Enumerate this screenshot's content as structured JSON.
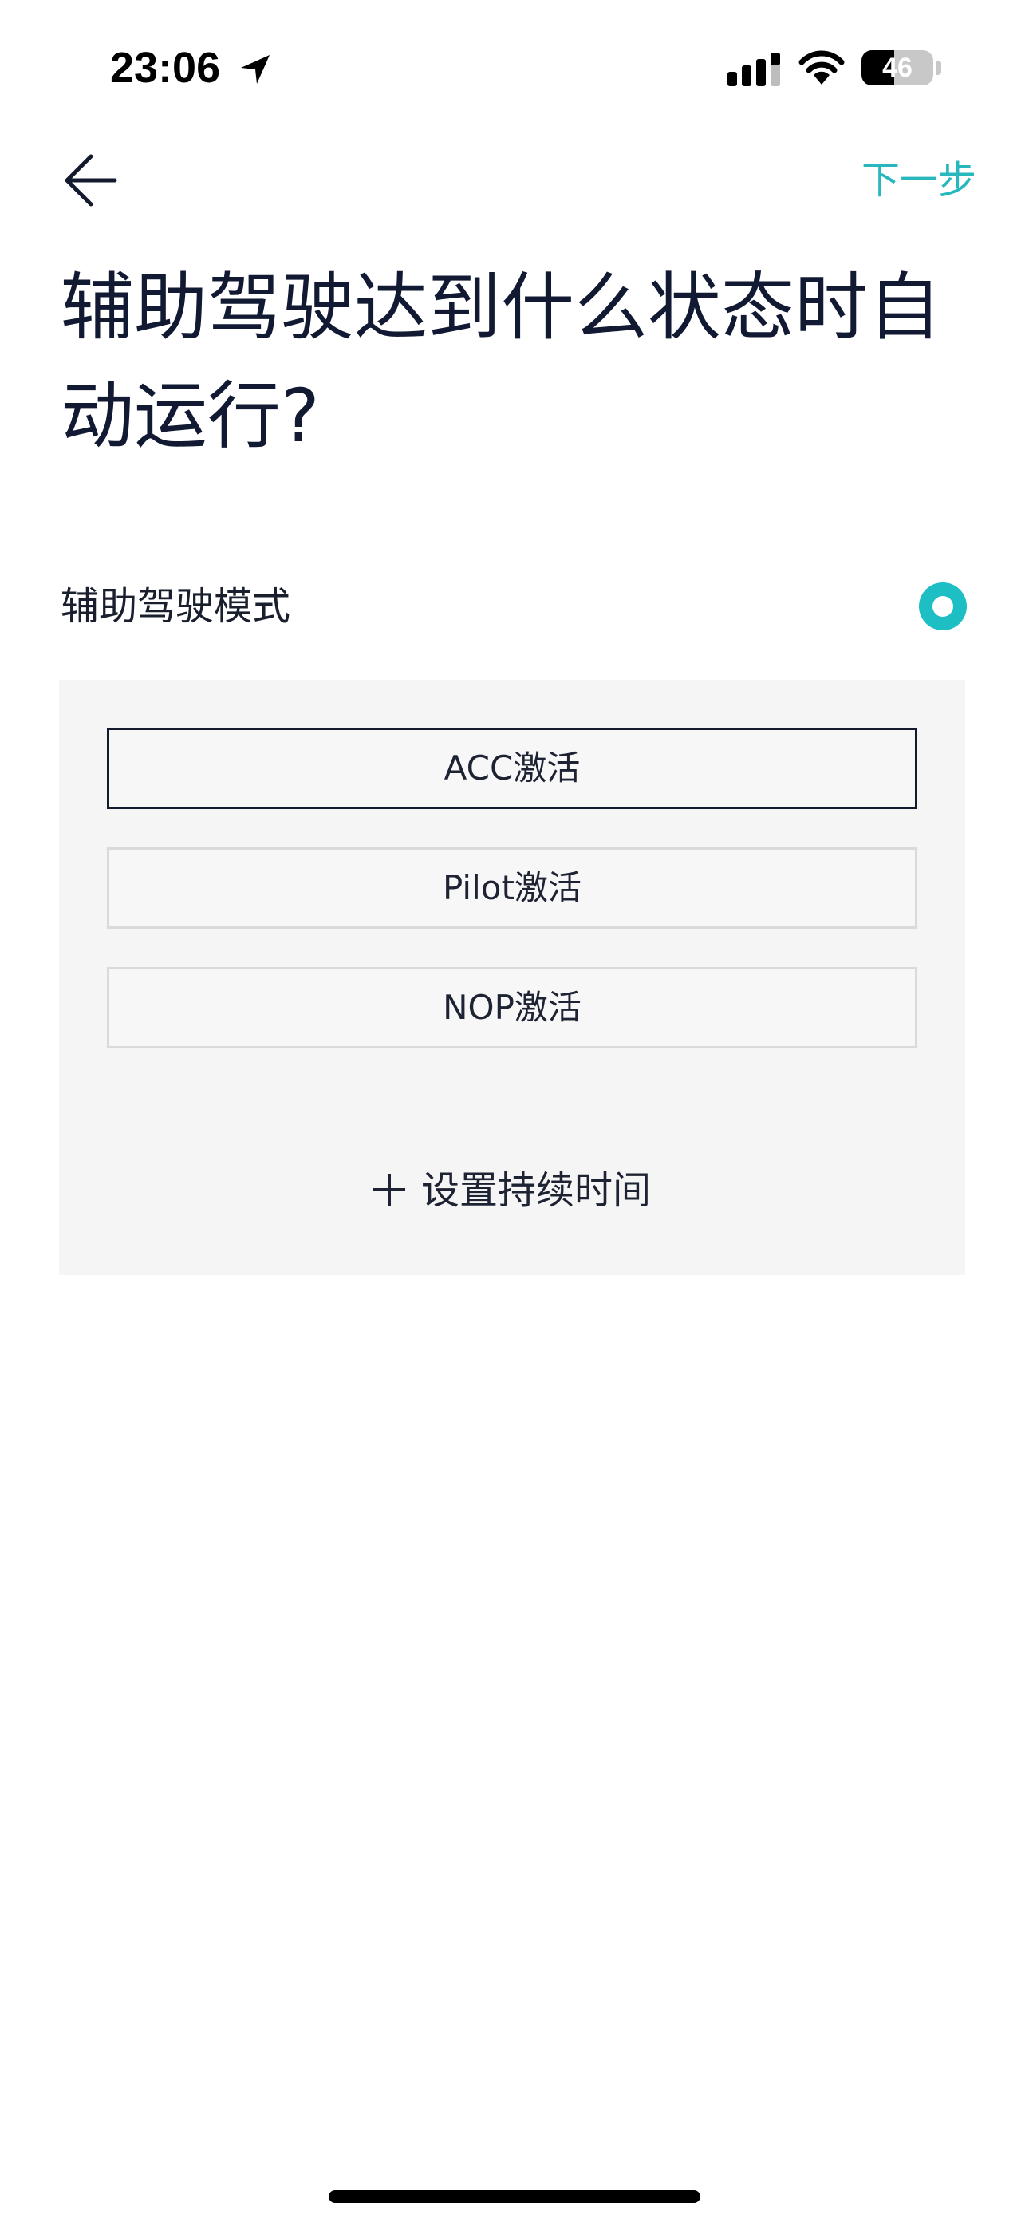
{
  "status_bar": {
    "time": "23:06",
    "location_icon": "location-arrow-icon",
    "signal_icon": "cellular-signal-icon",
    "wifi_icon": "wifi-icon",
    "battery_level": "46",
    "battery_fraction": 0.46
  },
  "nav": {
    "back_icon": "arrow-left-icon",
    "next_label": "下一步",
    "accent_color": "#27b8be"
  },
  "title": "辅助驾驶达到什么状态时自动运行?",
  "mode": {
    "label": "辅助驾驶模式",
    "toggle_icon": "radio-ring-icon",
    "toggle_color": "#1dbfc4"
  },
  "options": [
    {
      "label": "ACC激活",
      "selected": true
    },
    {
      "label": "Pilot激活",
      "selected": false
    },
    {
      "label": "NOP激活",
      "selected": false
    }
  ],
  "add_duration": {
    "icon": "plus-icon",
    "label": "设置持续时间"
  }
}
